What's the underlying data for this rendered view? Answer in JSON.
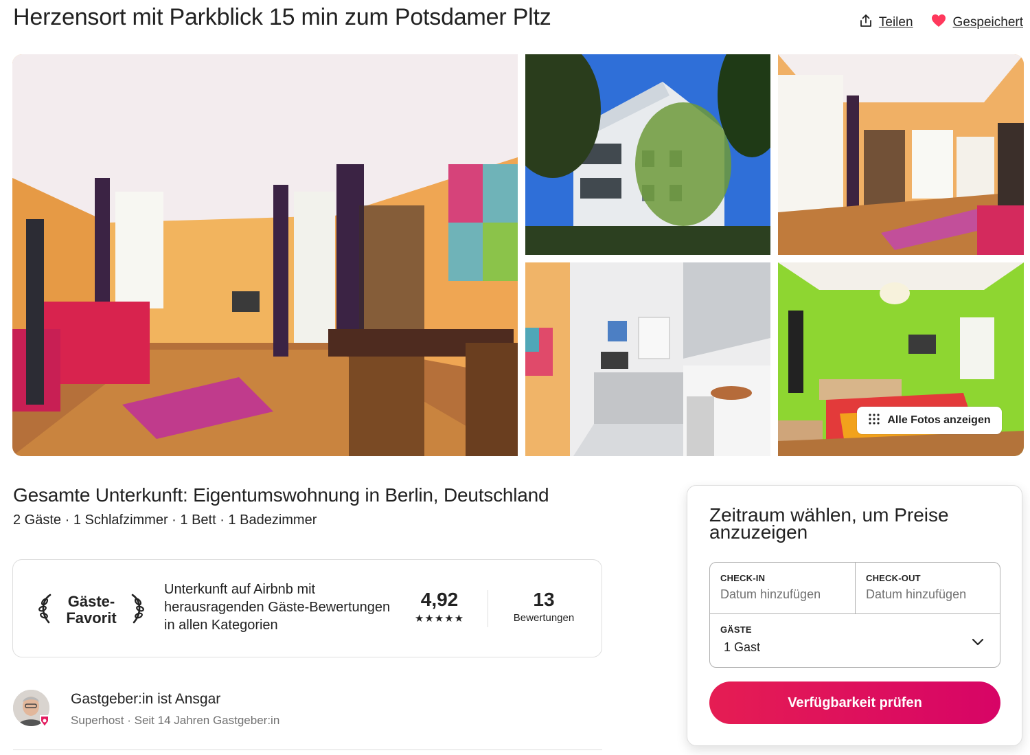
{
  "listing": {
    "title": "Herzensort mit Parkblick 15 min zum Potsdamer Pltz",
    "subtitle": "Gesamte Unterkunft: Eigentumswohnung in Berlin, Deutschland",
    "details": "2 Gäste · 1 Schlafzimmer · 1 Bett · 1 Badezimmer"
  },
  "actions": {
    "share_label": "Teilen",
    "save_label": "Gespeichert",
    "share_icon": "share-icon",
    "save_icon": "heart-icon",
    "save_color": "#ff385c"
  },
  "gallery": {
    "show_all_label": "Alle Fotos anzeigen",
    "photos": [
      "living-room",
      "building-exterior",
      "living-room-dining",
      "kitchen",
      "bedroom"
    ]
  },
  "guest_favorite": {
    "badge_line1": "Gäste-",
    "badge_line2": "Favorit",
    "description": "Unterkunft auf Airbnb mit herausragenden Gäste-Bewertungen in allen Kategorien",
    "rating": "4,92",
    "stars": "★★★★★",
    "reviews_count": "13",
    "reviews_label": "Bewertungen"
  },
  "host": {
    "name": "Gastgeber:in ist Ansgar",
    "meta": "Superhost · Seit 14 Jahren Gastgeber:in"
  },
  "booking": {
    "title": "Zeitraum wählen, um Preise anzuzeigen",
    "checkin_label": "CHECK-IN",
    "checkin_placeholder": "Datum hinzufügen",
    "checkout_label": "CHECK-OUT",
    "checkout_placeholder": "Datum hinzufügen",
    "guests_label": "GÄSTE",
    "guests_value": "1 Gast",
    "cta_label": "Verfügbarkeit prüfen",
    "accent": "#e31c5f"
  }
}
